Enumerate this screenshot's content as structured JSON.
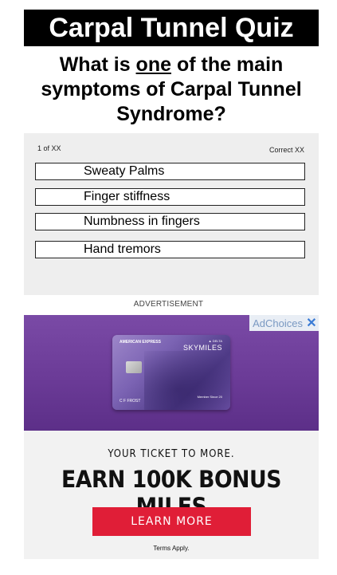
{
  "header": {
    "title": "Carpal Tunnel Quiz"
  },
  "question": {
    "prefix": "What is ",
    "emphasis": "one",
    "suffix": " of the main symptoms of Carpal Tunnel Syndrome?"
  },
  "quiz": {
    "counter": "1 of XX",
    "score": "Correct XX",
    "answers": [
      {
        "label": "Sweaty Palms"
      },
      {
        "label": "Finger stiffness"
      },
      {
        "label": "Numbness in fingers"
      },
      {
        "label": "Hand tremors"
      }
    ]
  },
  "ad": {
    "label": "ADVERTISEMENT",
    "adchoices": "AdChoices",
    "adchoices_close_icon": "close-icon",
    "card": {
      "brand": "AMERICAN EXPRESS",
      "delta": "▲ DELTA",
      "product": "SKYMILES",
      "holder": "C F FROST",
      "member_since": "Member Since 20"
    },
    "tagline": "YOUR TICKET TO MORE.",
    "headline": "EARN 100K BONUS MILES",
    "cta": "LEARN MORE",
    "terms": "Terms Apply.",
    "colors": {
      "cta": "#e01e37",
      "top_band": "#6b3b97"
    }
  }
}
